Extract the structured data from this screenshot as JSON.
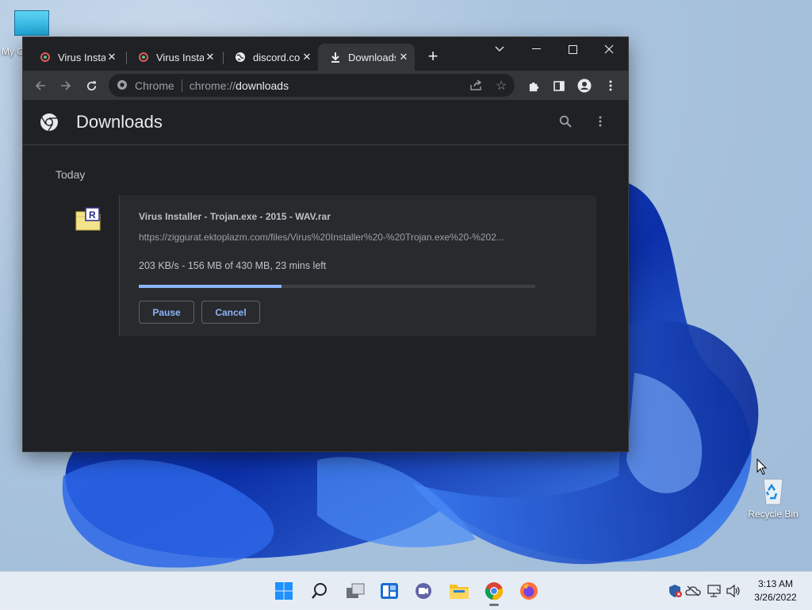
{
  "desktop": {
    "icons": [
      {
        "label": "My C"
      },
      {
        "label": "Recycle Bin"
      }
    ]
  },
  "window": {
    "tabs": [
      {
        "title": "Virus Installer",
        "icon": "virus-installer-favicon"
      },
      {
        "title": "Virus Installer",
        "icon": "virus-installer-favicon"
      },
      {
        "title": "discord.com",
        "icon": "globe-icon"
      },
      {
        "title": "Downloads",
        "icon": "download-icon",
        "active": true
      }
    ],
    "controls": {
      "minimize": "—",
      "maximize": "☐",
      "close": "✕"
    }
  },
  "omnibox": {
    "site_label": "Chrome",
    "scheme": "chrome://",
    "path": "downloads"
  },
  "page": {
    "title": "Downloads",
    "section": "Today",
    "download": {
      "filename": "Virus Installer - Trojan.exe - 2015 - WAV.rar",
      "url": "https://ziggurat.ektoplazm.com/files/Virus%20Installer%20-%20Trojan.exe%20-%202...",
      "status": "203 KB/s - 156 MB of 430 MB, 23 mins left",
      "progress": 0.36,
      "pause_label": "Pause",
      "cancel_label": "Cancel"
    }
  },
  "taskbar": {
    "clock_time": "3:13 AM",
    "clock_date": "3/26/2022"
  },
  "colors": {
    "accent": "#8ab4f8",
    "window_bg": "#202124",
    "toolbar_bg": "#35363a"
  }
}
